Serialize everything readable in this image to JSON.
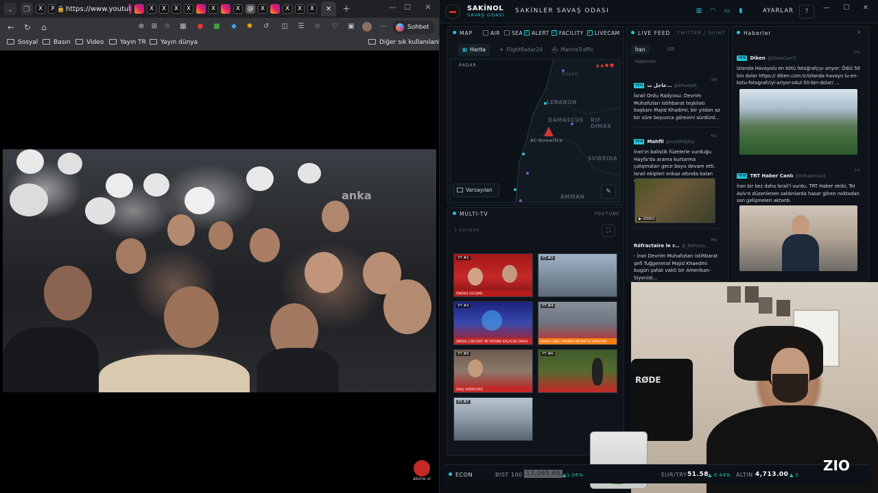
{
  "browser": {
    "url": "https://www.youtube...",
    "copilot_label": "Sohbet et",
    "bookmarks": [
      "Sosyal",
      "Basın",
      "Video",
      "Yayın TR",
      "Yayın dünya"
    ],
    "other_bookmarks": "Diğer sık kullanılanlar",
    "video_watermark": "anka",
    "channel_logo_text": "abone ol"
  },
  "dashboard": {
    "brand": "SAKİNOL",
    "brand_sub": "SAVAŞ ODASI",
    "room_title": "SAKİNLER SAVAŞ ODASI",
    "settings_label": "AYARLAR",
    "help_label": "?",
    "map_panel": {
      "title": "MAP",
      "layers": [
        {
          "label": "AIR",
          "checked": false
        },
        {
          "label": "SEA",
          "checked": false
        },
        {
          "label": "ALERT",
          "checked": true
        },
        {
          "label": "FACILITY",
          "checked": true
        },
        {
          "label": "LIVECAM",
          "checked": true
        }
      ],
      "tabs": [
        "Harita",
        "FlightRadar24",
        "MarineTraffic"
      ],
      "radar_label": "RADAR",
      "labels": [
        "LEBANON",
        "DAMASCUS",
        "RIF DIMAS",
        "SUWEIDA",
        "Al-Quneitra",
        "AMMAN",
        "Tripoli"
      ],
      "preset_button": "Varsayılan"
    },
    "multitv": {
      "title": "MULTI-TV",
      "source": "YOUTUBE",
      "count_label": "7 KAYNAK",
      "channels": [
        {
          "label": "YT #1",
          "ticker": "ÖNEMLİ GELİŞME"
        },
        {
          "label": "YT #2",
          "ticker": ""
        },
        {
          "label": "YT #3",
          "ticker": "SİNDAL CAN DÜZ 'İN YÜZÜNE KAÇACAK ODASI"
        },
        {
          "label": "YT #4",
          "ticker": "İSRAİL CANLI YAYINDA BEYRUT'U VURUYOR"
        },
        {
          "label": "YT #5",
          "ticker": "ARAÇ SÜRÜCÜSÜ"
        },
        {
          "label": "YT #6",
          "ticker": ""
        },
        {
          "label": "YT #7",
          "ticker": ""
        }
      ]
    },
    "livefeed": {
      "title": "LIVE FEED",
      "subtitle": "TWITTER / OSINT",
      "tabs": [
        "İran",
        "İSR",
        "Haberler"
      ],
      "items": [
        {
          "source": "عاجل ث...",
          "handle": "@Alhadath_",
          "time": "38s",
          "text": "İsrail Ordu Radyosu: Devrim Muhafızları istihbarat teşkilatı başkanı Majid Khadimi, bir yıldan az bir süre boyunca görevini sürdürd..."
        },
        {
          "source": "Mahfil",
          "handle": "@mahfildijital",
          "time": "41s",
          "text": "İran'ın balistik füzelerle vurduğu Hayfa'da arama kurtarma çalışmaları gece boyu devam etti. İsrail ekipleri enkaz altında kalan dört kişiden..."
        },
        {
          "source": "Réfractaire le r...",
          "handle": "@_Refracta...",
          "time": "44s",
          "text": "- İran Devrim Muhafızları istihbarat şefi Tuğgeneral Majid Khaedmi bugün şafak vakti bir Amerikan-Siyonist..."
        }
      ],
      "video_tag": "▶ VİDEO"
    },
    "news": {
      "title": "Haberler",
      "items": [
        {
          "source": "Diken",
          "handle": "@DikenComTr",
          "time": "27s",
          "text": "İzlanda Havayolu en kötü fotoğrafçıyı arıyor: Ödül 50 bin dolar https:// diken.com.tr/izlanda-havayo lu-en-kotu-fotografciyi-ariyor-odul-50-bin-dolar/ ..."
        },
        {
          "source": "TRT Haber Canlı",
          "handle": "@trthabercanli",
          "time": "1m",
          "text": "İran bir kez daha İsrail'i vurdu. TRT Haber ekibi, Tel Aviv'e düzenlenen saldırılarda hasar gören noktadan son gelişmeleri aktardı."
        }
      ]
    },
    "econ": {
      "title": "ECON",
      "bist_label": "BIST 100",
      "bist_value": "13,065.60",
      "bist_change": "▲1.06%",
      "eurtry_label": "EUR/TRY",
      "eurtry_value": "51.58",
      "eurtry_change": "▲ 0.44%",
      "altin_label": "ALTIN",
      "altin_value": "4,713.00",
      "altin_change": "▲ 0"
    },
    "stream_logo": "ZIO"
  },
  "colors": {
    "accent": "#26c6da",
    "alert_red": "#d32f2f",
    "up_green": "#26c6a3"
  }
}
